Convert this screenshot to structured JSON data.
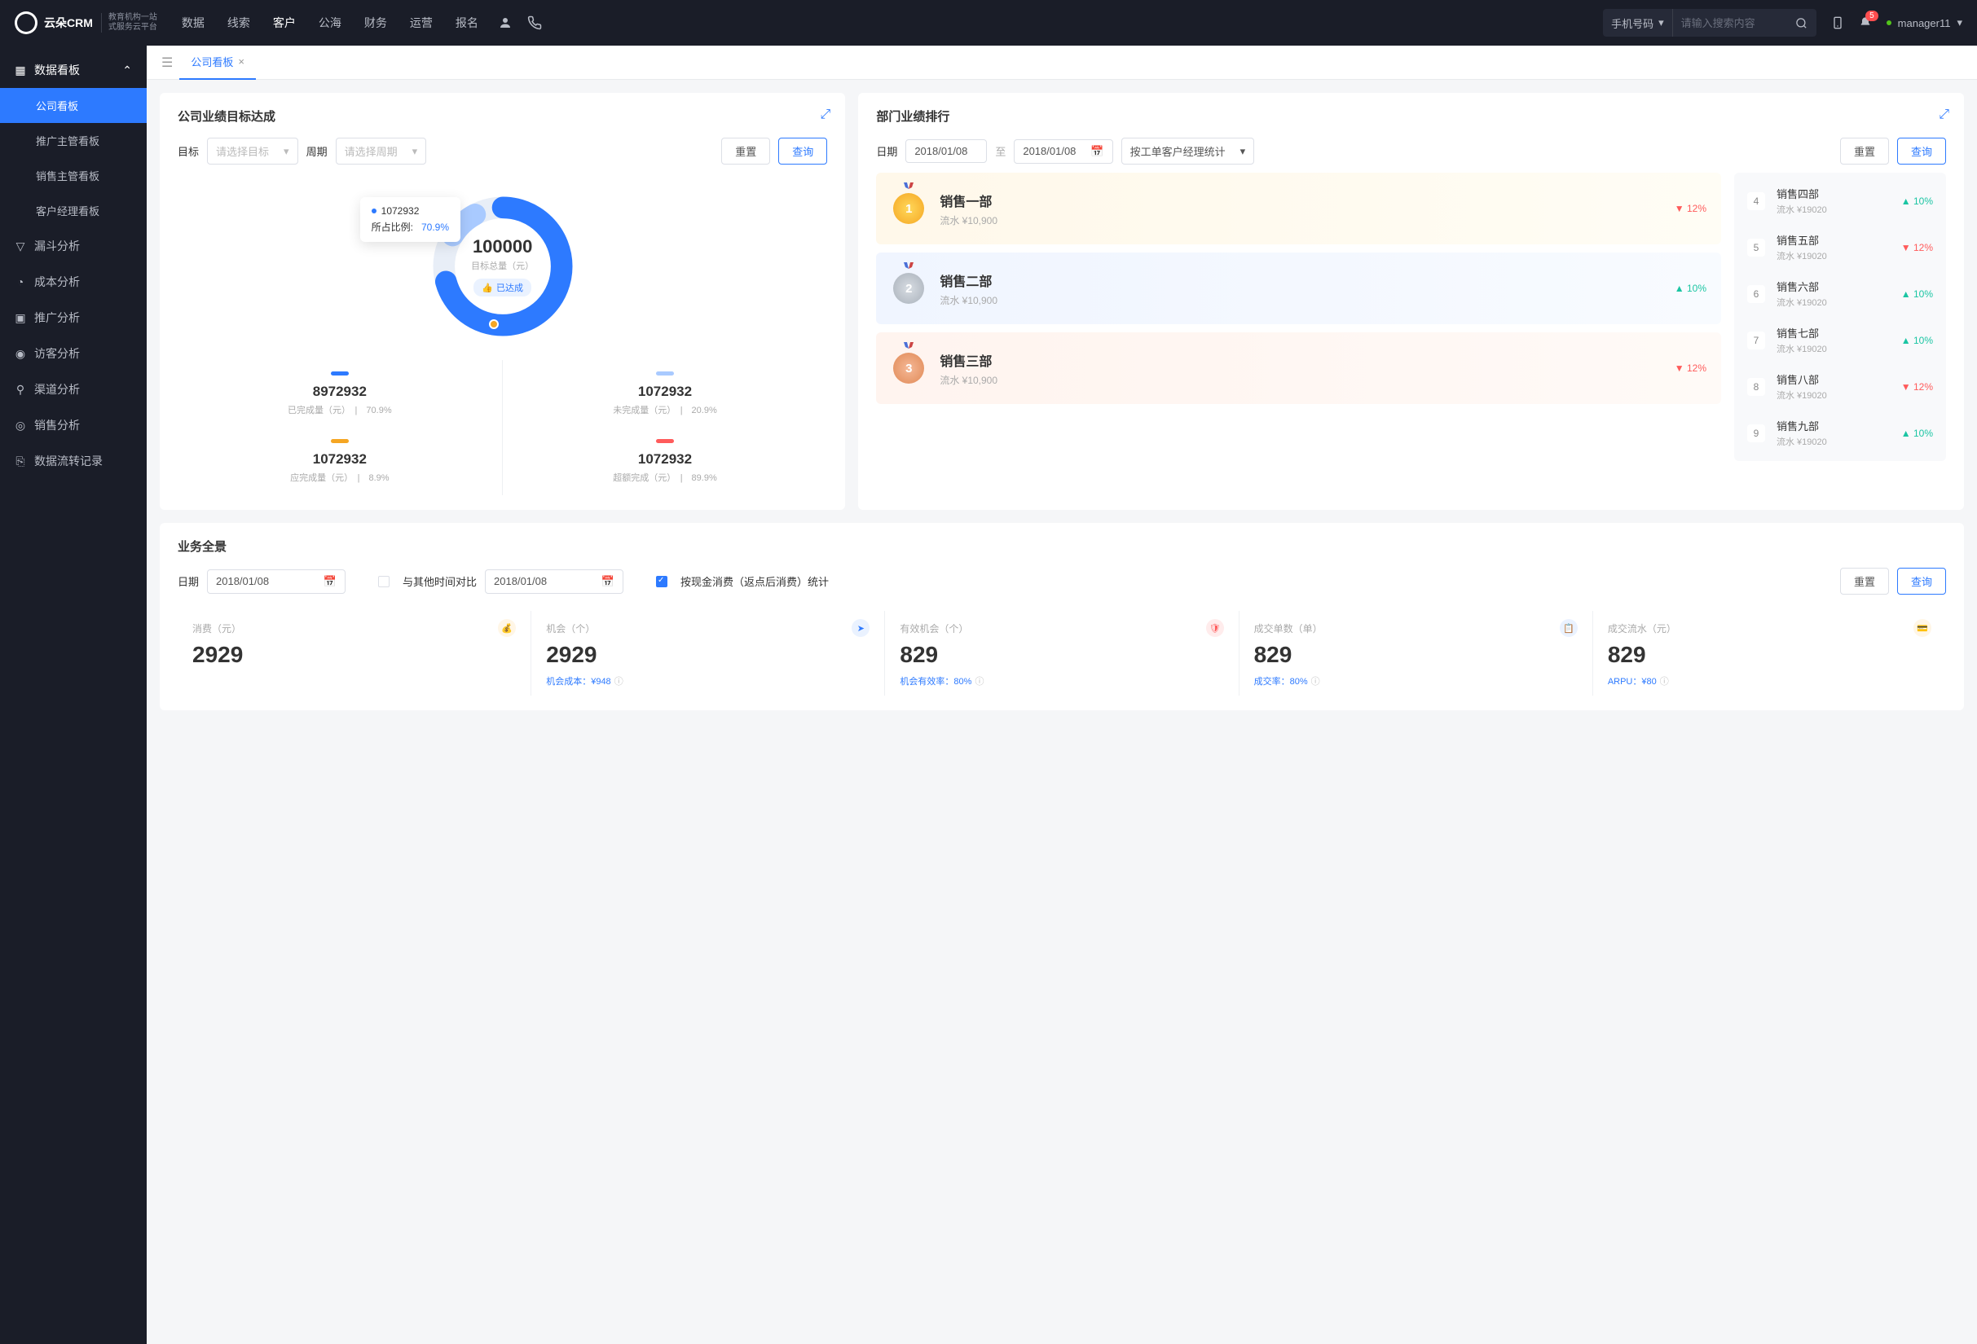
{
  "brand": {
    "name": "云朵CRM",
    "sub1": "教育机构一站",
    "sub2": "式服务云平台"
  },
  "nav": {
    "items": [
      "数据",
      "线索",
      "客户",
      "公海",
      "财务",
      "运营",
      "报名"
    ],
    "active": 2
  },
  "search": {
    "type": "手机号码",
    "placeholder": "请输入搜索内容"
  },
  "notif_count": "5",
  "username": "manager11",
  "sidebar": {
    "head": "数据看板",
    "items": [
      "公司看板",
      "推广主管看板",
      "销售主管看板",
      "客户经理看板"
    ],
    "active": 0,
    "links": [
      "漏斗分析",
      "成本分析",
      "推广分析",
      "访客分析",
      "渠道分析",
      "销售分析",
      "数据流转记录"
    ]
  },
  "tab": {
    "label": "公司看板"
  },
  "goal": {
    "title": "公司业绩目标达成",
    "labels": {
      "target": "目标",
      "period": "周期",
      "target_ph": "请选择目标",
      "period_ph": "请选择周期",
      "reset": "重置",
      "query": "查询"
    },
    "donut": {
      "total": "100000",
      "total_label": "目标总量（元）",
      "done_tag": "已达成",
      "tip_value": "1072932",
      "tip_label": "所占比例:",
      "tip_pct": "70.9%"
    },
    "metrics": [
      {
        "color": "#2d7aff",
        "value": "8972932",
        "label": "已完成量（元）",
        "pct": "70.9%"
      },
      {
        "color": "#a9caff",
        "value": "1072932",
        "label": "未完成量（元）",
        "pct": "20.9%"
      },
      {
        "color": "#f5a623",
        "value": "1072932",
        "label": "应完成量（元）",
        "pct": "8.9%"
      },
      {
        "color": "#ff5b5b",
        "value": "1072932",
        "label": "超额完成（元）",
        "pct": "89.9%"
      }
    ]
  },
  "rank": {
    "title": "部门业绩排行",
    "labels": {
      "date": "日期",
      "to": "至",
      "date1": "2018/01/08",
      "date2": "2018/01/08",
      "sorter": "按工单客户经理统计",
      "reset": "重置",
      "query": "查询"
    },
    "podium": [
      {
        "rank": "1",
        "name": "销售一部",
        "sub": "流水 ¥10,900",
        "pct": "12%",
        "dir": "down"
      },
      {
        "rank": "2",
        "name": "销售二部",
        "sub": "流水 ¥10,900",
        "pct": "10%",
        "dir": "up"
      },
      {
        "rank": "3",
        "name": "销售三部",
        "sub": "流水 ¥10,900",
        "pct": "12%",
        "dir": "down"
      }
    ],
    "list": [
      {
        "rank": "4",
        "name": "销售四部",
        "sub": "流水 ¥19020",
        "pct": "10%",
        "dir": "up"
      },
      {
        "rank": "5",
        "name": "销售五部",
        "sub": "流水 ¥19020",
        "pct": "12%",
        "dir": "down"
      },
      {
        "rank": "6",
        "name": "销售六部",
        "sub": "流水 ¥19020",
        "pct": "10%",
        "dir": "up"
      },
      {
        "rank": "7",
        "name": "销售七部",
        "sub": "流水 ¥19020",
        "pct": "10%",
        "dir": "up"
      },
      {
        "rank": "8",
        "name": "销售八部",
        "sub": "流水 ¥19020",
        "pct": "12%",
        "dir": "down"
      },
      {
        "rank": "9",
        "name": "销售九部",
        "sub": "流水 ¥19020",
        "pct": "10%",
        "dir": "up"
      }
    ]
  },
  "overview": {
    "title": "业务全景",
    "labels": {
      "date": "日期",
      "date1": "2018/01/08",
      "compare": "与其他时间对比",
      "date2": "2018/01/08",
      "cash": "按现金消费（返点后消费）统计",
      "reset": "重置",
      "query": "查询"
    },
    "cards": [
      {
        "label": "消费（元）",
        "value": "2929",
        "foot": "",
        "icon": "#f5a623",
        "bg": "#fff6e6"
      },
      {
        "label": "机会（个）",
        "value": "2929",
        "foot_label": "机会成本：",
        "foot_val": "¥948",
        "icon": "#2d7aff",
        "bg": "#eaf2ff"
      },
      {
        "label": "有效机会（个）",
        "value": "829",
        "foot_label": "机会有效率：",
        "foot_val": "80%",
        "icon": "#ff5b5b",
        "bg": "#ffecec"
      },
      {
        "label": "成交单数（单）",
        "value": "829",
        "foot_label": "成交率：",
        "foot_val": "80%",
        "icon": "#2d7aff",
        "bg": "#eaf2ff"
      },
      {
        "label": "成交流水（元）",
        "value": "829",
        "foot_label": "ARPU：",
        "foot_val": "¥80",
        "icon": "#f5a623",
        "bg": "#fff6e6"
      }
    ]
  },
  "chart_data": {
    "type": "pie",
    "title": "公司业绩目标达成",
    "total": 100000,
    "unit": "元",
    "segments": [
      {
        "name": "已完成量",
        "value": 8972932,
        "pct": 70.9,
        "color": "#2d7aff"
      },
      {
        "name": "未完成量",
        "value": 1072932,
        "pct": 20.9,
        "color": "#a9caff"
      },
      {
        "name": "应完成量",
        "value": 1072932,
        "pct": 8.9,
        "color": "#f5a623"
      },
      {
        "name": "超额完成",
        "value": 1072932,
        "pct": 89.9,
        "color": "#ff5b5b"
      }
    ]
  }
}
